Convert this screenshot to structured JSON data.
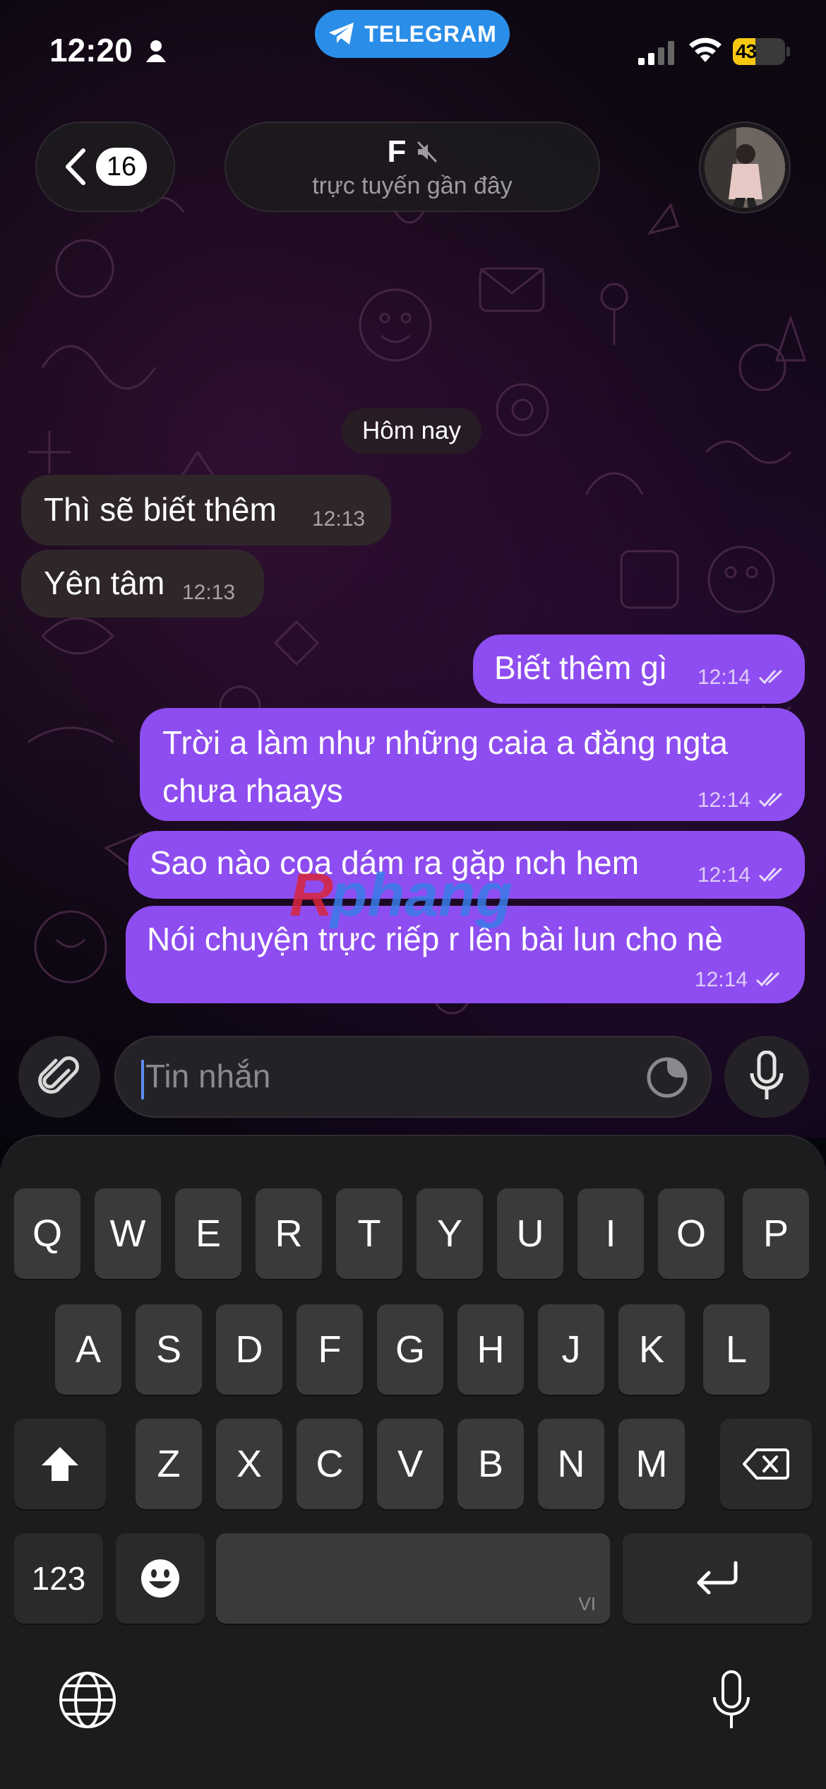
{
  "status_bar": {
    "time": "12:20",
    "pill_label": "TELEGRAM",
    "battery_text": "43",
    "battery_level_percent": 43,
    "battery_color": "#f6c812"
  },
  "header": {
    "back_count": "16",
    "chat_name": "F",
    "chat_status": "trực tuyến gần đây",
    "muted_icon": "muted-speaker-icon"
  },
  "chat": {
    "date_label": "Hôm nay",
    "messages": [
      {
        "direction": "incoming",
        "lines": [
          "Thì sẽ biết thêm"
        ],
        "time": "12:13"
      },
      {
        "direction": "incoming",
        "lines": [
          "Yên tâm"
        ],
        "time": "12:13"
      },
      {
        "direction": "outgoing",
        "lines": [
          "Biết thêm gì"
        ],
        "time": "12:14",
        "read": true
      },
      {
        "direction": "outgoing",
        "lines": [
          "Trời a làm như những caia a đăng ngta",
          "chưa rhaays"
        ],
        "time": "12:14",
        "read": true
      },
      {
        "direction": "outgoing",
        "lines": [
          "Sao nào coa dám ra gặp nch hem"
        ],
        "time": "12:14",
        "read": true
      },
      {
        "direction": "outgoing",
        "lines": [
          "Nói chuyện trực riếp r lên bài lun cho nè"
        ],
        "time": "12:14",
        "read": true
      }
    ],
    "watermark": "Rphang"
  },
  "composer": {
    "placeholder": "Tin nhắn"
  },
  "keyboard": {
    "row1": [
      "Q",
      "W",
      "E",
      "R",
      "T",
      "Y",
      "U",
      "I",
      "O",
      "P"
    ],
    "row2": [
      "A",
      "S",
      "D",
      "F",
      "G",
      "H",
      "J",
      "K",
      "L"
    ],
    "row3": [
      "Z",
      "X",
      "C",
      "V",
      "B",
      "N",
      "M"
    ],
    "numbers_key": "123",
    "language_label": "VI"
  },
  "colors": {
    "outgoing_bubble": "#8e4df0",
    "incoming_bubble": "#2f2629",
    "telegram_blue": "#2a8ee8"
  }
}
